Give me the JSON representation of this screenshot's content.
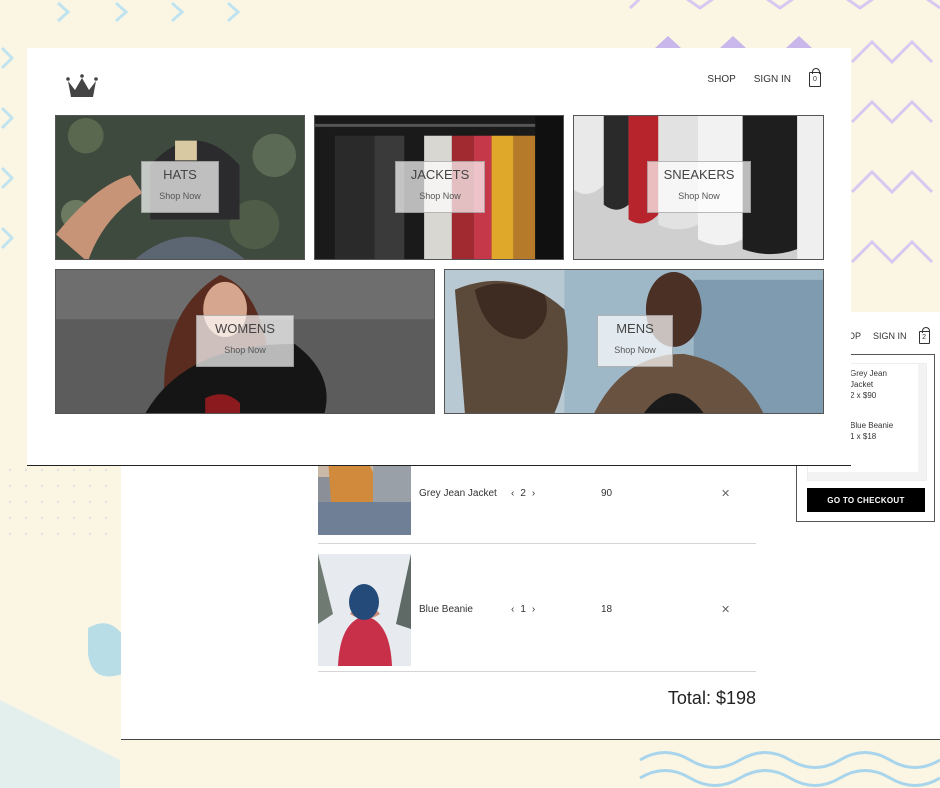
{
  "header": {
    "nav": {
      "shop": "SHOP",
      "sign_in": "SIGN IN",
      "bag_count": "0"
    }
  },
  "categories": [
    {
      "title": "HATS",
      "cta": "Shop Now"
    },
    {
      "title": "JACKETS",
      "cta": "Shop Now"
    },
    {
      "title": "SNEAKERS",
      "cta": "Shop Now"
    },
    {
      "title": "WOMENS",
      "cta": "Shop Now"
    },
    {
      "title": "MENS",
      "cta": "Shop Now"
    }
  ],
  "dropdown": {
    "nav_shop_partial": "OP",
    "nav_sign_in": "SIGN IN",
    "bag_count": "2",
    "items": [
      {
        "line1": "Grey Jean",
        "line2": "Jacket",
        "line3": "2 x $90"
      },
      {
        "line1": "Blue Beanie",
        "line2": "1 x $18"
      }
    ],
    "checkout_label": "GO TO CHECKOUT"
  },
  "checkout": {
    "rows": [
      {
        "name": "Grey Jean Jacket",
        "quantity": "2",
        "price": "90"
      },
      {
        "name": "Blue Beanie",
        "quantity": "1",
        "price": "18"
      }
    ],
    "total": "Total: $198"
  },
  "colors": {
    "background": "#fbf6e4",
    "button": "#000000",
    "deco_purple": "#c9b6ea",
    "deco_blue": "#a8d4ec"
  }
}
